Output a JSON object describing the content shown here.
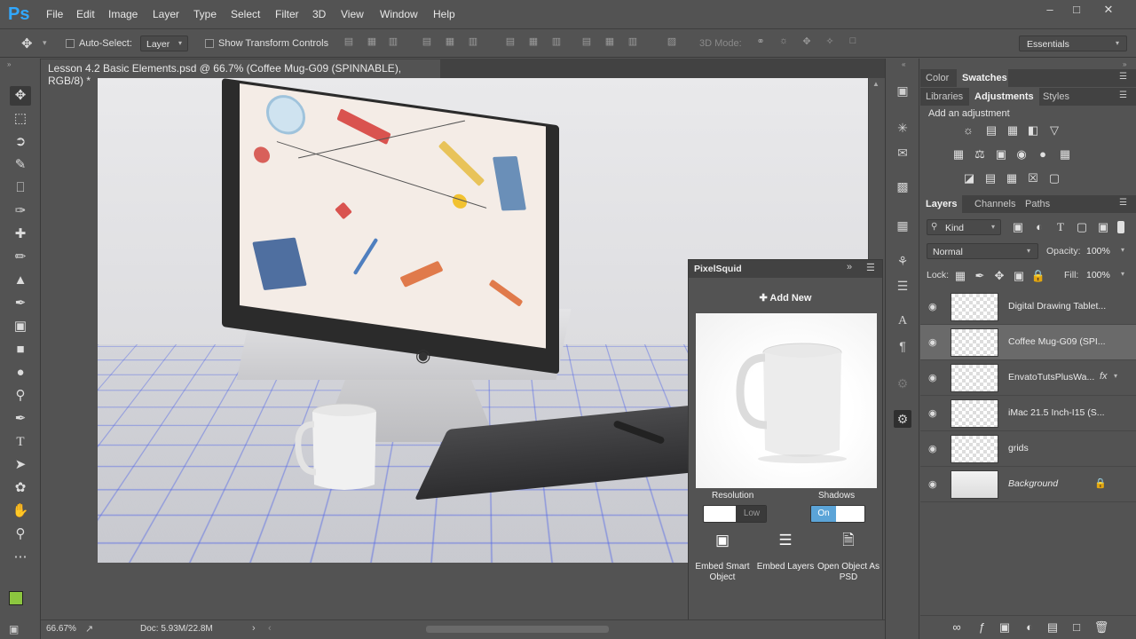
{
  "app": {
    "logo": "Ps"
  },
  "menu": [
    "File",
    "Edit",
    "Image",
    "Layer",
    "Type",
    "Select",
    "Filter",
    "3D",
    "View",
    "Window",
    "Help"
  ],
  "options": {
    "auto_select": "Auto-Select:",
    "auto_select_value": "Layer",
    "show_transform": "Show Transform Controls",
    "mode_3d": "3D Mode:",
    "workspace": "Essentials"
  },
  "document": {
    "tab_title": "Lesson 4.2 Basic Elements.psd @ 66.7% (Coffee Mug-G09 (SPINNABLE), RGB/8) *",
    "close": "×"
  },
  "status": {
    "zoom": "66.67%",
    "doc": "Doc: 5.93M/22.8M"
  },
  "pixelsquid": {
    "title": "PixelSquid",
    "add_new": "Add New",
    "resolution_label": "Resolution",
    "resolution_value": "Low",
    "shadows_label": "Shadows",
    "shadows_value": "On",
    "buttons": [
      {
        "label": "Embed Smart Object",
        "icon": "smart-object-icon"
      },
      {
        "label": "Embed Layers",
        "icon": "layers-stack-icon"
      },
      {
        "label": "Open Object As PSD",
        "icon": "psd-file-icon"
      }
    ]
  },
  "panels": {
    "top_tabs": [
      "Color",
      "Swatches"
    ],
    "adj_tabs": [
      "Libraries",
      "Adjustments",
      "Styles"
    ],
    "adj_heading": "Add an adjustment",
    "layer_tabs": [
      "Layers",
      "Channels",
      "Paths"
    ],
    "kind": "Kind",
    "blend_mode": "Normal",
    "opacity_label": "Opacity:",
    "opacity_value": "100%",
    "lock_label": "Lock:",
    "fill_label": "Fill:",
    "fill_value": "100%"
  },
  "layers": [
    {
      "name": "Digital Drawing Tablet...",
      "selected": false
    },
    {
      "name": "Coffee Mug-G09 (SPI...",
      "selected": true
    },
    {
      "name": "EnvatoTutsPlusWa...",
      "selected": false,
      "fx": "fx"
    },
    {
      "name": "iMac 21.5 Inch-I15 (S...",
      "selected": false
    },
    {
      "name": "grids",
      "selected": false
    },
    {
      "name": "Background",
      "selected": false
    }
  ],
  "colors": {
    "foreground": "#8cc63f",
    "background": "#ffffff",
    "accent": "#31a8ff"
  }
}
